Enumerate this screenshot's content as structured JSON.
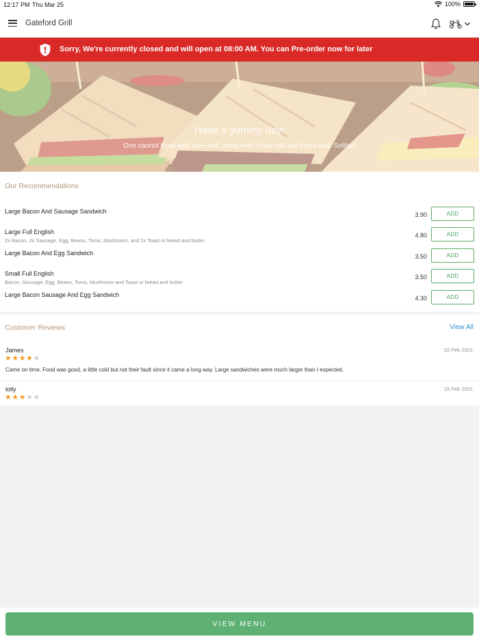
{
  "status_bar": {
    "time": "12:17 PM",
    "date": "Thu Mar 25",
    "battery": "100%"
  },
  "app_bar": {
    "title": "Gateford Grill",
    "menu_icon": "hamburger-icon",
    "bell_icon": "bell-icon",
    "mode_icon": "delivery-scooter-icon"
  },
  "closed_banner": {
    "icon": "shield-alert-icon",
    "message": "Sorry, We're currently closed and will open at 08:00 AM. You can Pre-order now for later",
    "color": "#da2a27"
  },
  "hero": {
    "headline": "Have a yummy day!",
    "quote": "One cannot think well, love well, sleep well, if one has not dined well. Solihull"
  },
  "recommendations": {
    "title": "Our Recommendations",
    "items": [
      {
        "name": "Large Bacon And Sausage Sandwich",
        "description": "",
        "price": "3.90",
        "action": "ADD"
      },
      {
        "name": "Large Full English",
        "description": "2x Bacon, 2x Sausage, Egg, Beans, Toms, Mushroom, and 2x Toast or bread and butter",
        "price": "4.80",
        "action": "ADD"
      },
      {
        "name": "Large Bacon And Egg Sandwich",
        "description": "",
        "price": "3.50",
        "action": "ADD"
      },
      {
        "name": "Small Full English",
        "description": "Bacon, Sausage, Egg, Beans, Toms, Mushroom and Toast or bread and butter",
        "price": "3.50",
        "action": "ADD"
      },
      {
        "name": "Large Bacon Sausage And Egg Sandwich",
        "description": "",
        "price": "4.30",
        "action": "ADD"
      }
    ]
  },
  "reviews": {
    "title": "Customer Reviews",
    "view_all": "View All",
    "items": [
      {
        "author": "James",
        "date": "22 Feb 2021",
        "rating": 4,
        "max_rating": 5,
        "text": "Came on time. Food was good, a little cold but not their fault since it came a long way. Large sandwiches were much larger than I expected,"
      },
      {
        "author": "lolly",
        "date": "15 Feb 2021",
        "rating": 3,
        "max_rating": 5,
        "text": ""
      }
    ]
  },
  "bottom": {
    "view_menu": "VIEW MENU",
    "accent": "#5eb173"
  }
}
